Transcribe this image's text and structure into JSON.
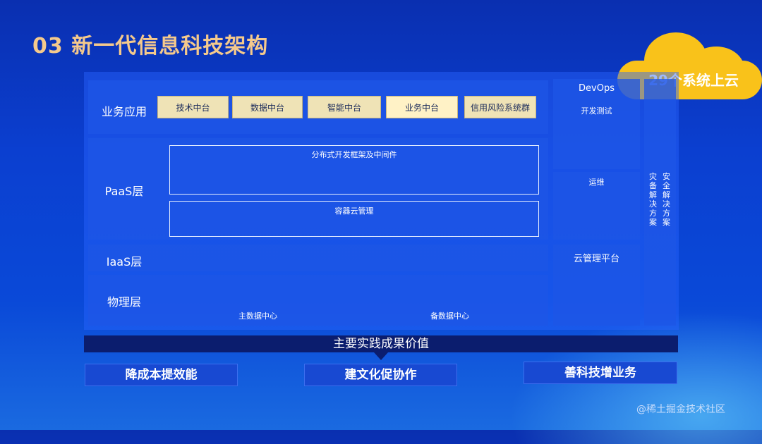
{
  "title": "03 新一代信息科技架构",
  "badge": "29个系统上云",
  "rows": {
    "business": "业务应用",
    "paas": "PaaS层",
    "iaas": "IaaS层",
    "physical": "物理层"
  },
  "apps": [
    "技术中台",
    "数据中台",
    "智能中台",
    "业务中台",
    "信用风险系统群"
  ],
  "paas": {
    "framework_title": "分布式开发框架及中间件",
    "framework_items": [
      "",
      "",
      "",
      "",
      "",
      ""
    ],
    "container_title": "容器云管理",
    "container_items": [
      "",
      "",
      "",
      ""
    ]
  },
  "iaas_items": [
    "",
    "",
    "",
    "",
    ""
  ],
  "physical": {
    "items": [
      "",
      "",
      "",
      "",
      "",
      ""
    ],
    "main_dc": "主数据中心",
    "backup_dc": "备数据中心"
  },
  "devops": {
    "title": "DevOps",
    "dev_test": "开发测试",
    "ops": "运维",
    "cloud_mgmt": "云管理平台"
  },
  "side": {
    "disaster": "灾备解决方案",
    "security": "安全解决方案"
  },
  "summary_bar": "主要实践成果价值",
  "results": [
    "降成本提效能",
    "建文化促协作",
    "善科技增业务"
  ],
  "watermark": "@稀土掘金技术社区",
  "colors": {
    "background": "#0b3fd0",
    "title": "#f4c98c",
    "badge": "#f9c21a",
    "app_box": "#efe3b6",
    "bar": "#0b1d6e"
  }
}
